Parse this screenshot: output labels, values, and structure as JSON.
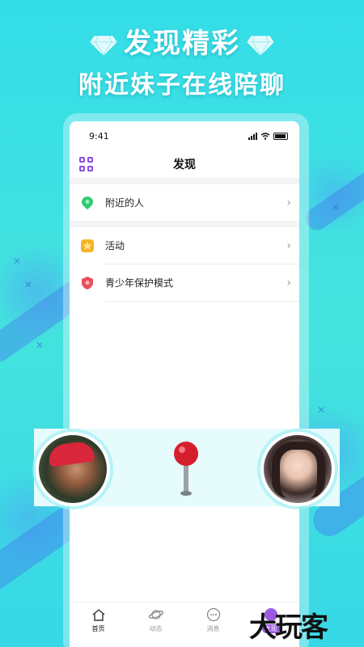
{
  "promo": {
    "headline_1": "发现精彩",
    "headline_2": "附近妹子在线陪聊"
  },
  "status": {
    "time": "9:41"
  },
  "nav": {
    "title": "发现"
  },
  "menu": [
    {
      "label": "附近的人",
      "icon": "location-icon",
      "color": "#2ecc71"
    },
    {
      "label": "活动",
      "icon": "star-icon",
      "color": "#f5b32a"
    },
    {
      "label": "青少年保护模式",
      "icon": "shield-icon",
      "color": "#e8505b"
    }
  ],
  "tabs": [
    {
      "label": "首页",
      "icon": "home-icon"
    },
    {
      "label": "动态",
      "icon": "planet-icon"
    },
    {
      "label": "消息",
      "icon": "message-icon"
    },
    {
      "label": "发现",
      "icon": "discover-icon"
    }
  ],
  "watermark": "大玩客",
  "colors": {
    "accent": "#8c4ce0",
    "background": "#3ee0e4"
  }
}
